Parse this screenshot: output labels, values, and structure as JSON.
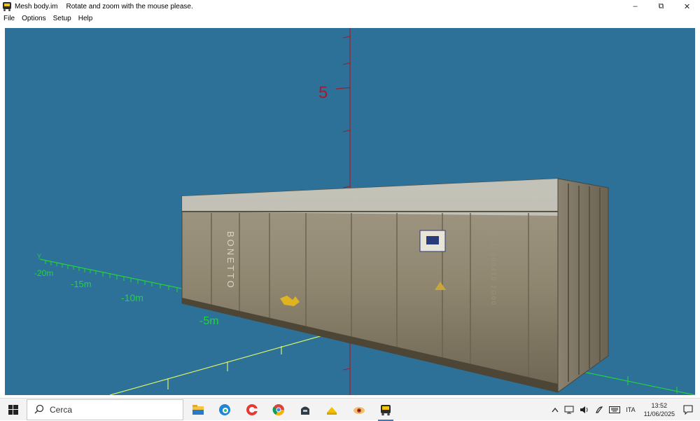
{
  "window": {
    "title": "Mesh body.im",
    "message": "Rotate and zoom with the mouse please.",
    "controls": {
      "minimize": "–",
      "maximize": "⧉",
      "close": "✕"
    }
  },
  "menu": {
    "items": [
      "File",
      "Options",
      "Setup",
      "Help"
    ]
  },
  "scene": {
    "background": "#2d7199",
    "z_axis_label": "5",
    "y_axis_name": "Y",
    "y_ticks": [
      "-20m",
      "-15m",
      "-10m",
      "-5m"
    ],
    "axis_colors": {
      "z": "#a01c2e",
      "y": "#22d43a",
      "x": "#d6f06a"
    },
    "container_logo": "BONETTO",
    "container_code": "BGCU 200410 2G00"
  },
  "taskbar": {
    "search_placeholder": "Cerca",
    "apps": [
      "file-explorer",
      "edge-browser",
      "ccleaner",
      "chrome-browser",
      "dark-app",
      "yellow-app",
      "eye-app",
      "mesh-viewer-app"
    ],
    "tray": {
      "language": "ITA",
      "time": "13:52",
      "date": "11/06/2025"
    }
  }
}
